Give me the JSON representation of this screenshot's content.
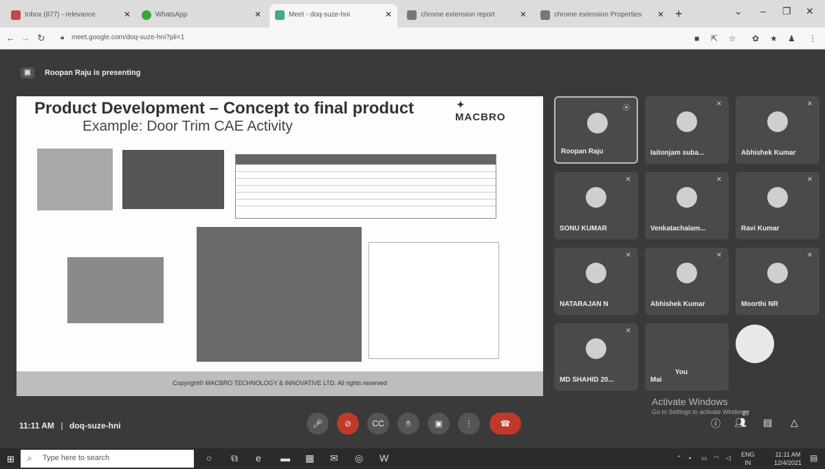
{
  "browser": {
    "tabs": [
      {
        "title": "Inbox (877) - relevance"
      },
      {
        "title": "WhatsApp"
      },
      {
        "title": "Meet - doq-suze-hni"
      },
      {
        "title": "chrome extension report"
      },
      {
        "title": "chrome extension Properties"
      }
    ],
    "url": "meet.google.com/doq-suze-hni?pli=1"
  },
  "meet": {
    "presenting_text": "Roopan Raju is presenting",
    "slide": {
      "title": "Product Development – Concept to final product",
      "subtitle": "Example: Door Trim CAE Activity",
      "logo": "MACBRO",
      "copyright": "Copyright© MACBRO TECHNOLOGY & INNOVATIVE LTD. All rights reserved"
    },
    "participants": [
      {
        "name": "Roopan Raju"
      },
      {
        "name": "Iaitonjam suba..."
      },
      {
        "name": "Abhishek Kumar"
      },
      {
        "name": "SONU KUMAR"
      },
      {
        "name": "Venkatachalam..."
      },
      {
        "name": "Ravi Kumar"
      },
      {
        "name": "NATARAJAN N"
      },
      {
        "name": "Abhishek Kumar"
      },
      {
        "name": "Moorthi NR"
      },
      {
        "name": "MD SHAHID 20..."
      }
    ],
    "self": {
      "label_you": "You",
      "label_more": "Mai"
    },
    "time": "11:11 AM",
    "meeting_code": "doq-suze-hni",
    "activate_title": "Activate Windows",
    "activate_sub": "Go to Settings to activate Windows.",
    "participant_count": "27"
  },
  "taskbar": {
    "search_placeholder": "Type here to search",
    "lang": "ENG",
    "lang2": "IN",
    "time": "11:11 AM",
    "date": "12/4/2021"
  },
  "colors": {
    "stage": "#3a3a3a",
    "tile": "#4a4a4a",
    "end_call": "#c0392b",
    "taskbar": "#2b2b2b"
  }
}
